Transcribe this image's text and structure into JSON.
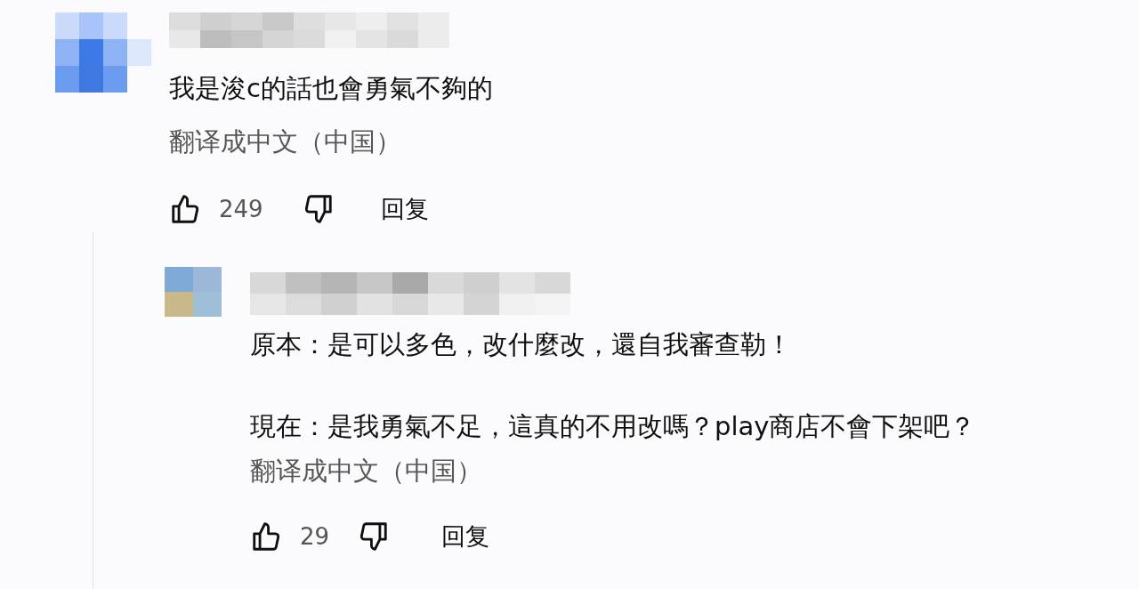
{
  "comment": {
    "text": "我是浚c的話也會勇氣不夠的",
    "translate_link": "翻译成中文（中国）",
    "like_count": "249",
    "reply_label": "回复"
  },
  "reply": {
    "paragraphs": [
      "原本：是可以多色，改什麼改，還自我審查勒！",
      "現在：是我勇氣不足，這真的不用改嗎？play商店不會下架吧？"
    ],
    "translate_link": "翻译成中文（中国）",
    "like_count": "29",
    "reply_label": "回复"
  }
}
